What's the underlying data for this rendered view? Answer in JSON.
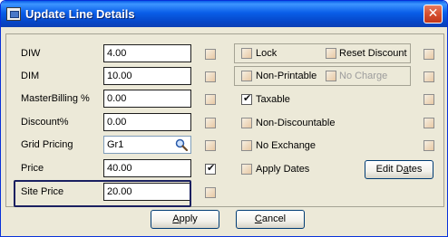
{
  "window": {
    "title": "Update Line Details",
    "close_glyph": "✕"
  },
  "fields": [
    {
      "label": "DIW",
      "value": "4.00"
    },
    {
      "label": "DIM",
      "value": "10.00"
    },
    {
      "label": "MasterBilling %",
      "value": "0.00"
    },
    {
      "label": "Discount%",
      "value": "0.00"
    },
    {
      "label": "Grid Pricing",
      "value": "Gr1"
    },
    {
      "label": "Price",
      "value": "40.00"
    },
    {
      "label": "Site Price",
      "value": "20.00"
    }
  ],
  "field_checks": [
    false,
    false,
    false,
    false,
    false,
    true,
    false
  ],
  "options": {
    "lock": "Lock",
    "reset_discount": "Reset Discount",
    "non_printable": "Non-Printable",
    "no_charge": "No Charge",
    "taxable": "Taxable",
    "non_discountable": "Non-Discountable",
    "no_exchange": "No Exchange",
    "apply_dates": "Apply Dates"
  },
  "buttons": {
    "edit_dates_pre": "Edit D",
    "edit_dates_acc": "a",
    "edit_dates_post": "tes",
    "apply_acc": "A",
    "apply_post": "pply",
    "cancel_acc": "C",
    "cancel_post": "ancel"
  },
  "icons": {
    "grid_lookup": "search-icon"
  }
}
